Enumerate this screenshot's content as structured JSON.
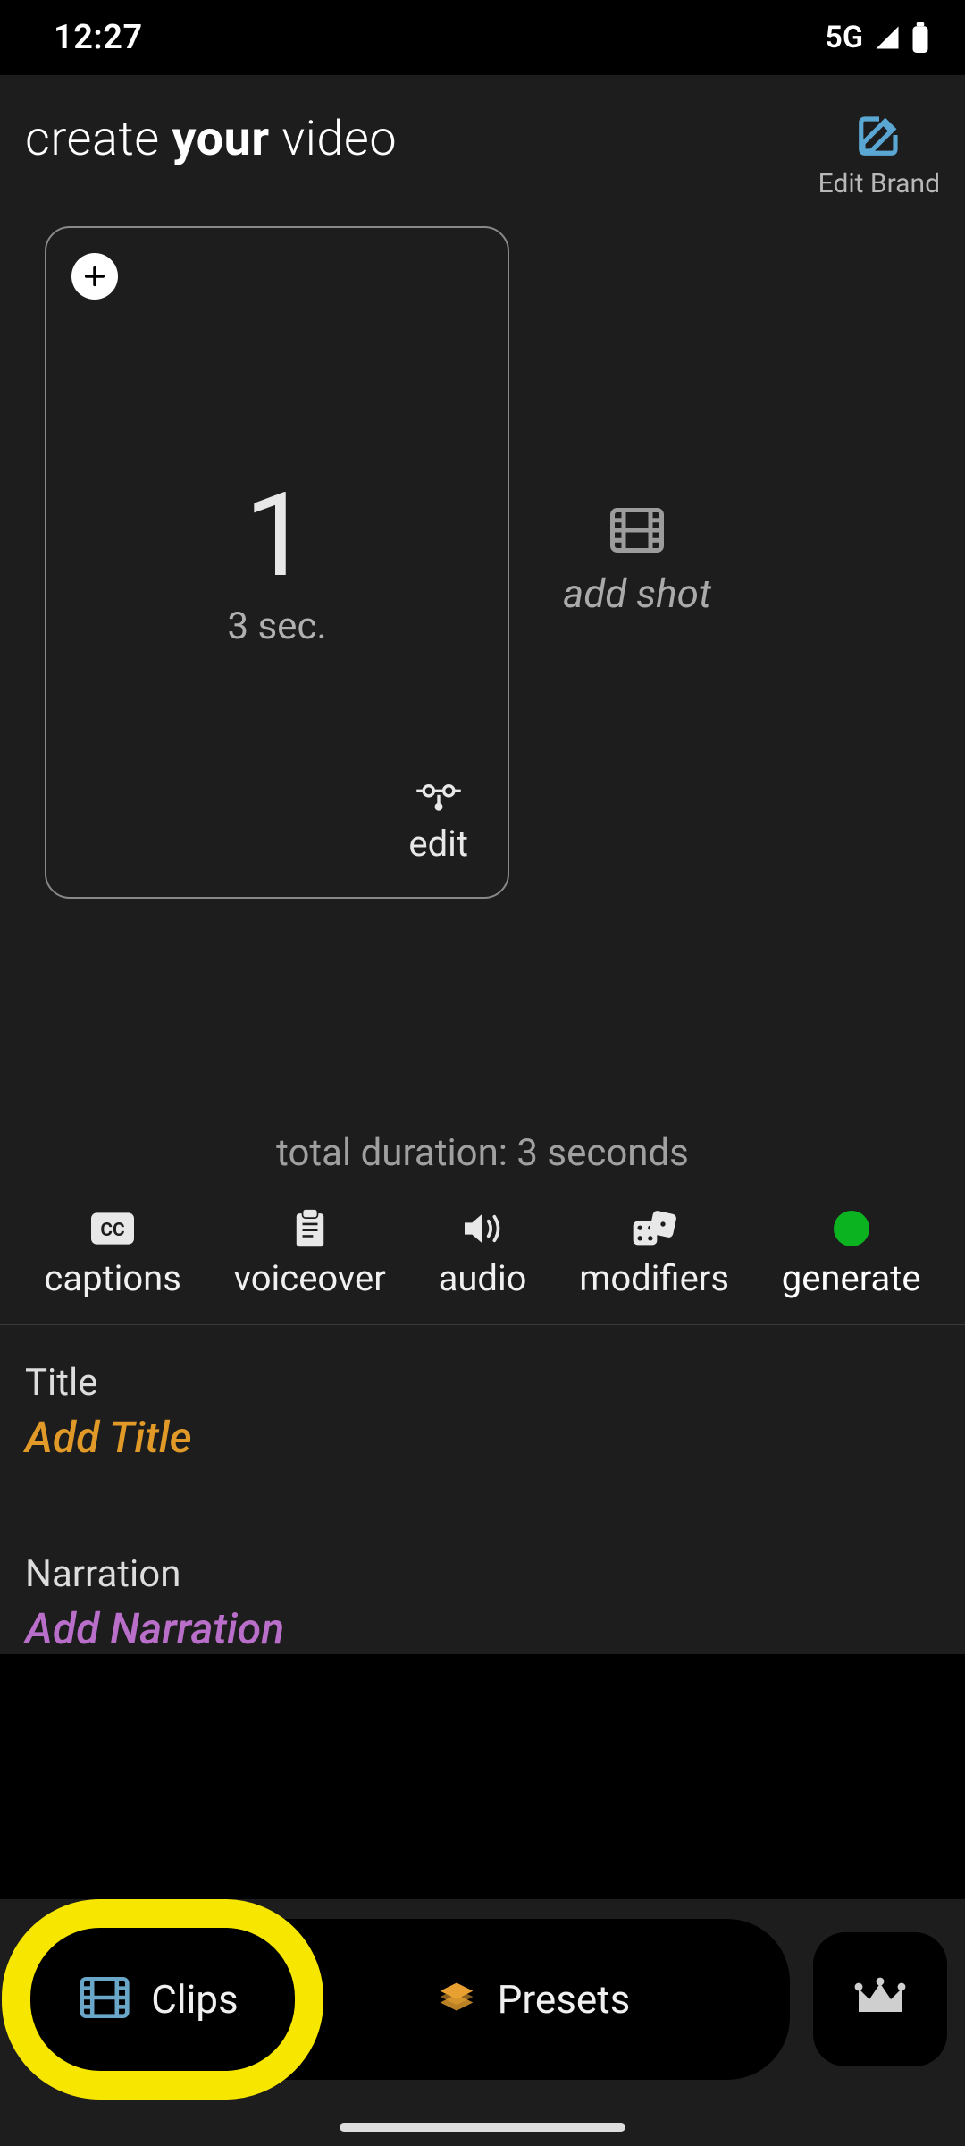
{
  "status": {
    "time": "12:27",
    "network": "5G"
  },
  "header": {
    "title_pre": "create ",
    "title_bold": "your",
    "title_post": " video",
    "edit_brand_label": "Edit Brand"
  },
  "shots": [
    {
      "number": "1",
      "duration": "3 sec.",
      "edit_label": "edit"
    }
  ],
  "add_shot_label": "add shot",
  "total_duration": "total duration: 3 seconds",
  "tools": {
    "captions": "captions",
    "voiceover": "voiceover",
    "audio": "audio",
    "modifiers": "modifiers",
    "generate": "generate"
  },
  "fields": {
    "title_label": "Title",
    "title_placeholder": "Add Title",
    "narration_label": "Narration",
    "narration_placeholder": "Add Narration"
  },
  "nav": {
    "clips": "Clips",
    "presets": "Presets"
  },
  "colors": {
    "accent_blue": "#5aa7d4",
    "highlight_yellow": "#f7e600",
    "generate_green": "#0bb321",
    "title_orange": "#e19a28",
    "narration_purple": "#b96fc9"
  }
}
